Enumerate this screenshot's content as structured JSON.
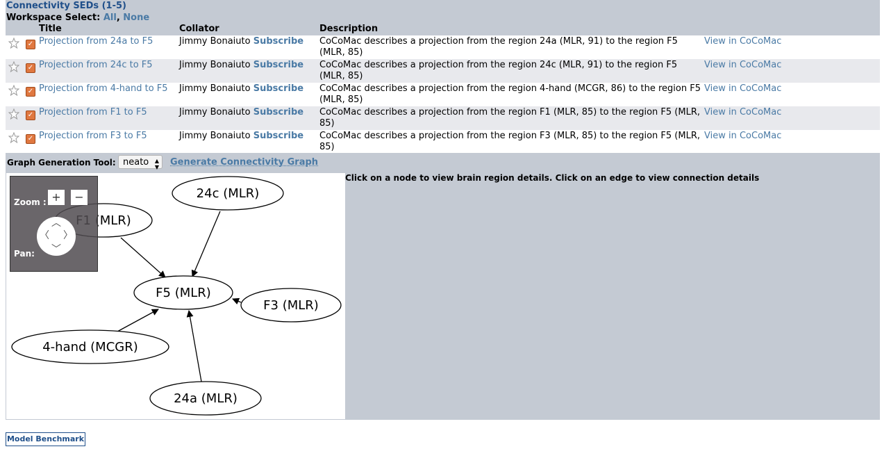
{
  "heading": "Connectivity SEDs (1-5)",
  "workspace_select": {
    "label": "Workspace Select:",
    "all": "All",
    "none": "None"
  },
  "columns": {
    "title": "Title",
    "collator": "Collator",
    "description": "Description"
  },
  "rows": [
    {
      "title": "Projection from 24a to F5",
      "collator": "Jimmy Bonaiuto",
      "subscribe": "Subscribe",
      "description": "CoCoMac describes a projection from the region 24a (MLR, 91) to the region F5 (MLR, 85)",
      "view": "View in CoCoMac",
      "checked": true
    },
    {
      "title": "Projection from 24c to F5",
      "collator": "Jimmy Bonaiuto",
      "subscribe": "Subscribe",
      "description": "CoCoMac describes a projection from the region 24c (MLR, 91) to the region F5 (MLR, 85)",
      "view": "View in CoCoMac",
      "checked": true
    },
    {
      "title": "Projection from 4-hand to F5",
      "collator": "Jimmy Bonaiuto",
      "subscribe": "Subscribe",
      "description": "CoCoMac describes a projection from the region 4-hand (MCGR, 86) to the region F5 (MLR, 85)",
      "view": "View in CoCoMac",
      "checked": true
    },
    {
      "title": "Projection from F1 to F5",
      "collator": "Jimmy Bonaiuto",
      "subscribe": "Subscribe",
      "description": "CoCoMac describes a projection from the region F1 (MLR, 85) to the region F5 (MLR, 85)",
      "view": "View in CoCoMac",
      "checked": true
    },
    {
      "title": "Projection from F3 to F5",
      "collator": "Jimmy Bonaiuto",
      "subscribe": "Subscribe",
      "description": "CoCoMac describes a projection from the region F3 (MLR, 85) to the region F5 (MLR, 85)",
      "view": "View in CoCoMac",
      "checked": true
    }
  ],
  "graph_tool": {
    "label": "Graph Generation Tool:",
    "selected": "neato",
    "generate": "Generate Connectivity Graph"
  },
  "graph_hint": "Click on a node to view brain region details. Click on an edge to view connection details",
  "zoom_pan": {
    "zoom_label": "Zoom :",
    "pan_label": "Pan:",
    "zoom_in": "+",
    "zoom_out": "−"
  },
  "graph": {
    "nodes": [
      {
        "id": "F1",
        "label": "F1 (MLR)"
      },
      {
        "id": "24c",
        "label": "24c (MLR)"
      },
      {
        "id": "F5",
        "label": "F5 (MLR)"
      },
      {
        "id": "F3",
        "label": "F3 (MLR)"
      },
      {
        "id": "4hand",
        "label": "4-hand (MCGR)"
      },
      {
        "id": "24a",
        "label": "24a (MLR)"
      }
    ],
    "edges": [
      {
        "from": "F1",
        "to": "F5"
      },
      {
        "from": "24c",
        "to": "F5"
      },
      {
        "from": "F3",
        "to": "F5"
      },
      {
        "from": "4hand",
        "to": "F5"
      },
      {
        "from": "24a",
        "to": "F5"
      }
    ]
  },
  "benchmark_button": "Model Benchmark",
  "colors": {
    "panel": "#c4cad3",
    "link": "#4a7aa5",
    "heading": "#1f4f8a",
    "checkbox": "#e07840"
  }
}
